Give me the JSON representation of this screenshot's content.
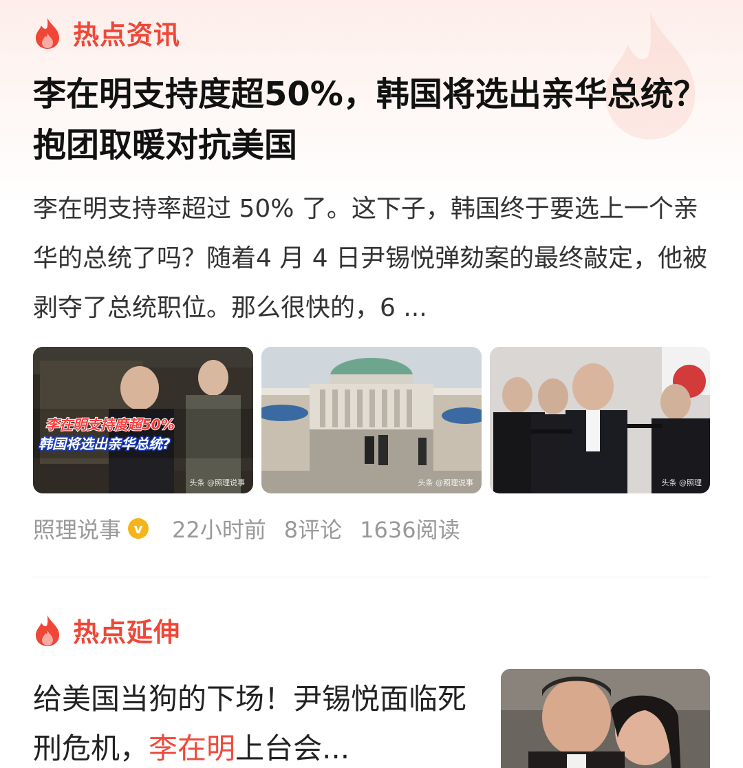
{
  "section1": {
    "label": "热点资讯",
    "icon": "flame-icon"
  },
  "article": {
    "headline": "李在明支持度超50%，韩国将选出亲华总统？抱团取暖对抗美国",
    "summary": "李在明支持率超过 50% 了。这下子，韩国终于要选上一个亲华的总统了吗？随着4 月 4 日尹锡悦弹劾案的最终敲定，他被剥夺了总统职位。那么很快的，6 ...",
    "thumb1_caption_line1": "李在明支持度超50%",
    "thumb1_caption_line2": "韩国将选出亲华总统?",
    "thumb1_watermark": "头条 @照理说事",
    "thumb2_watermark": "头条 @照理说事",
    "thumb3_watermark": "头条 @照理",
    "author": "照理说事",
    "verified_mark": "v",
    "time": "22小时前",
    "comments": "8评论",
    "reads": "1636阅读"
  },
  "section2": {
    "label": "热点延伸",
    "icon": "flame-icon"
  },
  "related": {
    "title_part1": "给美国当狗的下场！尹锡悦面临死刑危机，",
    "title_highlight": "李在明",
    "title_part2": "上台会..."
  },
  "colors": {
    "accent": "#f04637",
    "highlight": "#ef4a3c",
    "verified": "#f5b51a",
    "meta_text": "#999999"
  }
}
